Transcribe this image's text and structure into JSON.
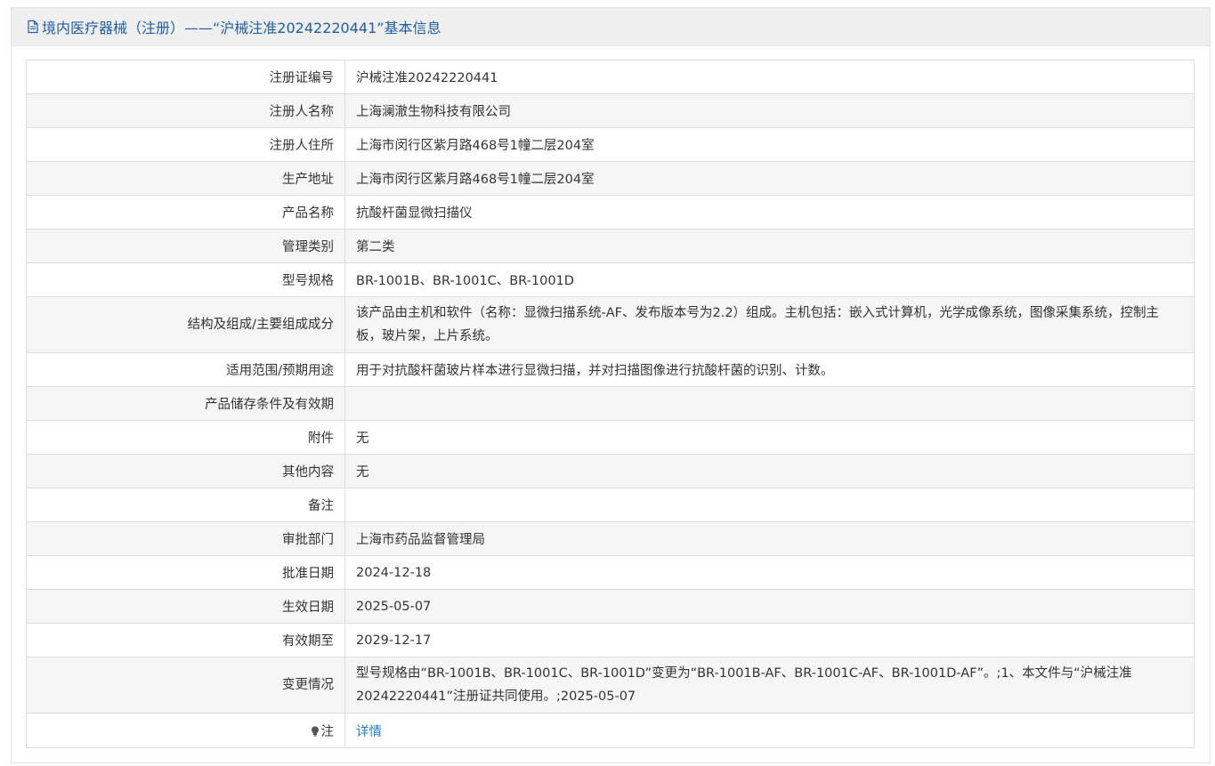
{
  "header": {
    "title": "境内医疗器械（注册）——“沪械注准20242220441”基本信息"
  },
  "rows": [
    {
      "label": "注册证编号",
      "value": "沪械注准20242220441"
    },
    {
      "label": "注册人名称",
      "value": "上海澜澈生物科技有限公司"
    },
    {
      "label": "注册人住所",
      "value": "上海市闵行区紫月路468号1幢二层204室"
    },
    {
      "label": "生产地址",
      "value": "上海市闵行区紫月路468号1幢二层204室"
    },
    {
      "label": "产品名称",
      "value": "抗酸杆菌显微扫描仪"
    },
    {
      "label": "管理类别",
      "value": "第二类"
    },
    {
      "label": "型号规格",
      "value": "BR-1001B、BR-1001C、BR-1001D"
    },
    {
      "label": "结构及组成/主要组成成分",
      "value": "该产品由主机和软件（名称：显微扫描系统-AF、发布版本号为2.2）组成。主机包括：嵌入式计算机，光学成像系统，图像采集系统，控制主板，玻片架，上片系统。"
    },
    {
      "label": "适用范围/预期用途",
      "value": "用于对抗酸杆菌玻片样本进行显微扫描，并对扫描图像进行抗酸杆菌的识别、计数。"
    },
    {
      "label": "产品储存条件及有效期",
      "value": ""
    },
    {
      "label": "附件",
      "value": "无"
    },
    {
      "label": "其他内容",
      "value": "无"
    },
    {
      "label": "备注",
      "value": ""
    },
    {
      "label": "审批部门",
      "value": "上海市药品监督管理局"
    },
    {
      "label": "批准日期",
      "value": "2024-12-18"
    },
    {
      "label": "生效日期",
      "value": "2025-05-07"
    },
    {
      "label": "有效期至",
      "value": "2029-12-17"
    },
    {
      "label": "变更情况",
      "value": "型号规格由“BR-1001B、BR-1001C、BR-1001D”变更为“BR-1001B-AF、BR-1001C-AF、BR-1001D-AF”。;1、本文件与“沪械注准20242220441”注册证共同使用。;2025-05-07"
    }
  ],
  "note": {
    "label": "注",
    "link_text": "详情",
    "icon": "lightbulb-icon"
  },
  "colors": {
    "header_text": "#1f5f9f",
    "link": "#1f7fd0",
    "stripe": "#f5f5f5"
  }
}
